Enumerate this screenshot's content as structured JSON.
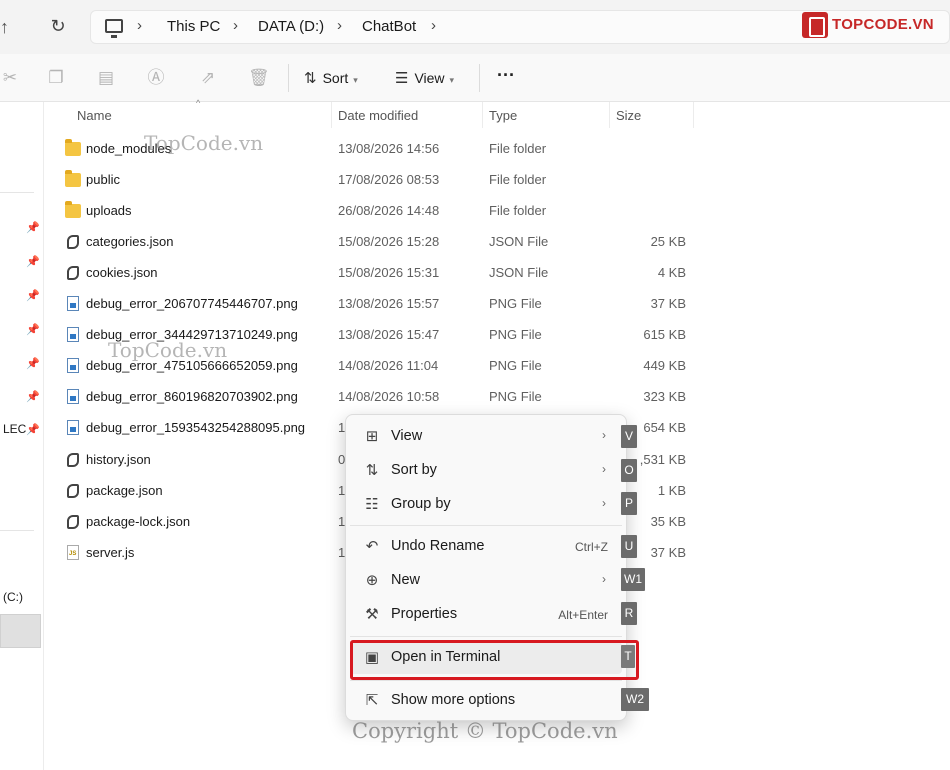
{
  "address": {
    "crumbs": [
      "This PC",
      "DATA (D:)",
      "ChatBot"
    ]
  },
  "logo": {
    "text": "TOPCODE.VN"
  },
  "toolbar": {
    "sort_label": "Sort",
    "view_label": "View",
    "more_label": "···"
  },
  "nav": {
    "lec_label": "LEC",
    "drive_c_label": "(C:)"
  },
  "columns": {
    "name": "Name",
    "date": "Date modified",
    "type": "Type",
    "size": "Size"
  },
  "files": [
    {
      "name": "node_modules",
      "date": "13/08/2026 14:56",
      "type": "File folder",
      "size": "",
      "icon": "folder-icon"
    },
    {
      "name": "public",
      "date": "17/08/2026 08:53",
      "type": "File folder",
      "size": "",
      "icon": "folder-icon"
    },
    {
      "name": "uploads",
      "date": "26/08/2026 14:48",
      "type": "File folder",
      "size": "",
      "icon": "folder-icon"
    },
    {
      "name": "categories.json",
      "date": "15/08/2026 15:28",
      "type": "JSON File",
      "size": "25 KB",
      "icon": "json-file-icon"
    },
    {
      "name": "cookies.json",
      "date": "15/08/2026 15:31",
      "type": "JSON File",
      "size": "4 KB",
      "icon": "json-file-icon"
    },
    {
      "name": "debug_error_206707745446707.png",
      "date": "13/08/2026 15:57",
      "type": "PNG File",
      "size": "37 KB",
      "icon": "png-file-icon"
    },
    {
      "name": "debug_error_344429713710249.png",
      "date": "13/08/2026 15:47",
      "type": "PNG File",
      "size": "615 KB",
      "icon": "png-file-icon"
    },
    {
      "name": "debug_error_475105666652059.png",
      "date": "14/08/2026 11:04",
      "type": "PNG File",
      "size": "449 KB",
      "icon": "png-file-icon"
    },
    {
      "name": "debug_error_860196820703902.png",
      "date": "14/08/2026 10:58",
      "type": "PNG File",
      "size": "323 KB",
      "icon": "png-file-icon"
    },
    {
      "name": "debug_error_1593543254288095.png",
      "date": "1",
      "type": "",
      "size": "654 KB",
      "icon": "png-file-icon"
    },
    {
      "name": "history.json",
      "date": "0",
      "type": "",
      "size": ",531 KB",
      "icon": "json-file-icon"
    },
    {
      "name": "package.json",
      "date": "1",
      "type": "",
      "size": "1 KB",
      "icon": "json-file-icon"
    },
    {
      "name": "package-lock.json",
      "date": "1",
      "type": "",
      "size": "35 KB",
      "icon": "json-file-icon"
    },
    {
      "name": "server.js",
      "date": "1",
      "type": "",
      "size": "37 KB",
      "icon": "js-file-icon"
    }
  ],
  "context_menu": {
    "items": [
      {
        "label": "View",
        "shortcut": "",
        "submenu": true,
        "key": "V",
        "icon": "grid-icon"
      },
      {
        "label": "Sort by",
        "shortcut": "",
        "submenu": true,
        "key": "O",
        "icon": "sort-icon"
      },
      {
        "label": "Group by",
        "shortcut": "",
        "submenu": true,
        "key": "P",
        "icon": "group-icon"
      },
      {
        "label": "Undo Rename",
        "shortcut": "Ctrl+Z",
        "submenu": false,
        "key": "U",
        "icon": "undo-icon"
      },
      {
        "label": "New",
        "shortcut": "",
        "submenu": true,
        "key": "W1",
        "icon": "new-icon"
      },
      {
        "label": "Properties",
        "shortcut": "Alt+Enter",
        "submenu": false,
        "key": "R",
        "icon": "wrench-icon"
      },
      {
        "label": "Open in Terminal",
        "shortcut": "",
        "submenu": false,
        "key": "T",
        "icon": "terminal-icon"
      },
      {
        "label": "Show more options",
        "shortcut": "",
        "submenu": false,
        "key": "W2",
        "icon": "share-icon"
      }
    ]
  },
  "watermarks": {
    "small1": "TopCode.vn",
    "small2": "TopCode.vn",
    "copyright": "Copyright © TopCode.vn"
  }
}
